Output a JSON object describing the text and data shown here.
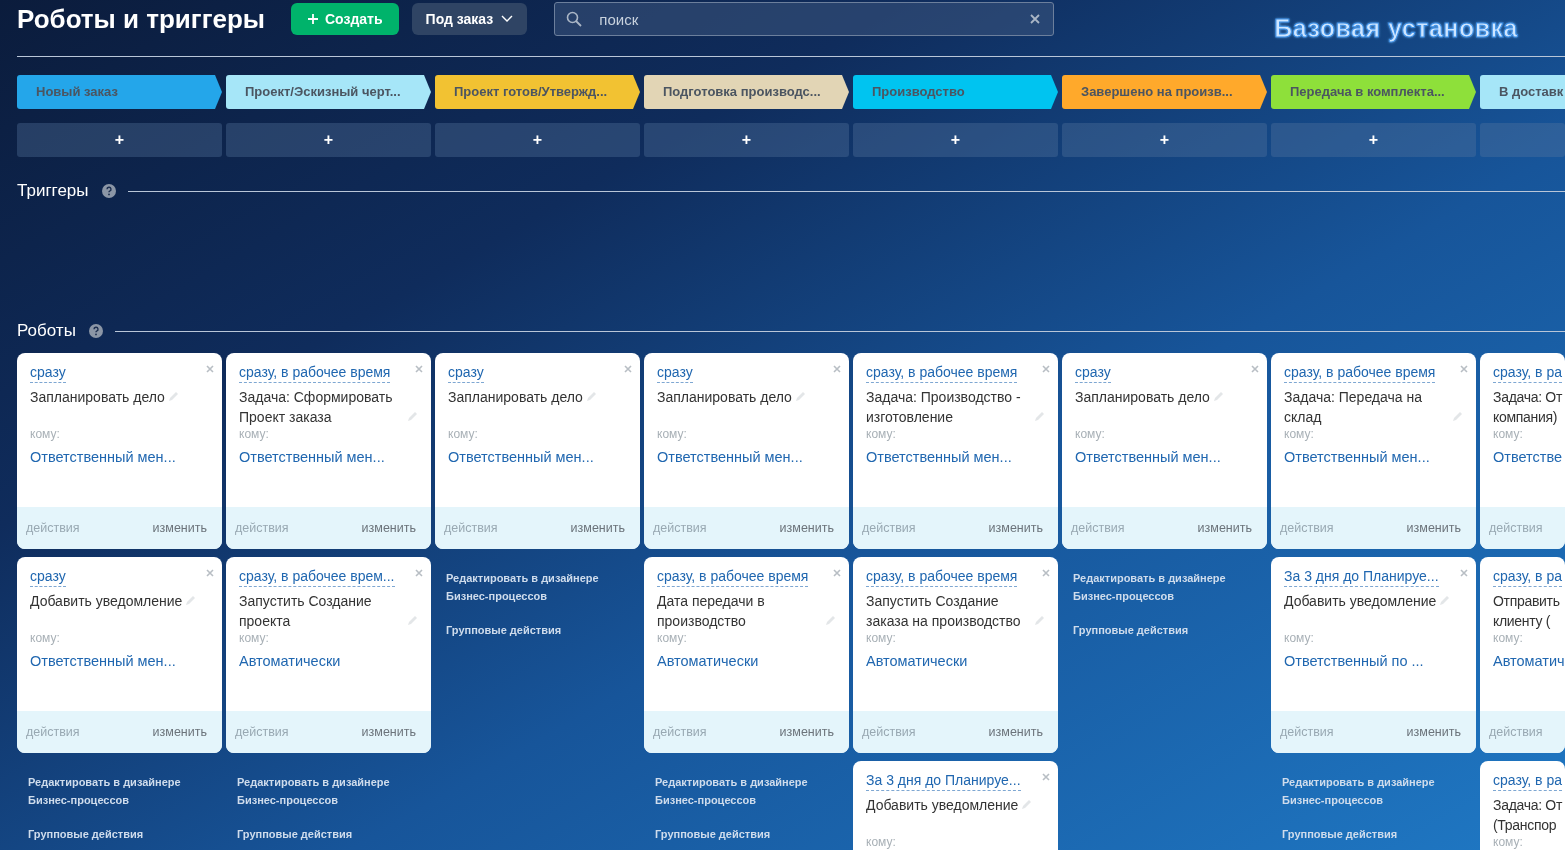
{
  "header": {
    "title": "Роботы и триггеры",
    "create_button": "Создать",
    "mode_dropdown": "Под заказ",
    "search": {
      "placeholder": "поиск"
    },
    "config_name": "Базовая установка"
  },
  "triggers": {
    "title": "Триггеры"
  },
  "robots": {
    "title": "Роботы"
  },
  "columns": [
    {
      "stage": {
        "label": "Новый заказ",
        "color": "#24a6ea"
      },
      "add": "+",
      "cards": [
        {
          "delay": "сразу",
          "title": "Запланировать дело",
          "to_label": "кому:",
          "to": "Ответственный мен...",
          "actions": "действия",
          "edit": "изменить"
        },
        {
          "delay": "сразу",
          "title": "Добавить уведомление",
          "to_label": "кому:",
          "to": "Ответственный мен...",
          "actions": "действия",
          "edit": "изменить"
        }
      ],
      "links": [
        "Редактировать в дизайнере Бизнес-процессов",
        "Групповые действия"
      ]
    },
    {
      "stage": {
        "label": "Проект/Эскизный черт...",
        "color": "#a6e6f8"
      },
      "add": "+",
      "cards": [
        {
          "delay": "сразу, в рабочее время",
          "title": "Задача: Сформировать Проект заказа",
          "to_label": "кому:",
          "to": "Ответственный мен...",
          "actions": "действия",
          "edit": "изменить"
        },
        {
          "delay": "сразу, в рабочее врем...",
          "title": "Запустить Создание проекта",
          "to_label": "кому:",
          "to": "Автоматически",
          "actions": "действия",
          "edit": "изменить"
        }
      ],
      "links": [
        "Редактировать в дизайнере Бизнес-процессов",
        "Групповые действия"
      ]
    },
    {
      "stage": {
        "label": "Проект готов/Утвержд...",
        "color": "#f2c232"
      },
      "add": "+",
      "cards": [
        {
          "delay": "сразу",
          "title": "Запланировать дело",
          "to_label": "кому:",
          "to": "Ответственный мен...",
          "actions": "действия",
          "edit": "изменить"
        }
      ],
      "links": [
        "Редактировать в дизайнере Бизнес-процессов",
        "Групповые действия"
      ]
    },
    {
      "stage": {
        "label": "Подготовка производс...",
        "color": "#e2d5b5"
      },
      "add": "+",
      "cards": [
        {
          "delay": "сразу",
          "title": "Запланировать дело",
          "to_label": "кому:",
          "to": "Ответственный мен...",
          "actions": "действия",
          "edit": "изменить"
        },
        {
          "delay": "сразу, в рабочее время",
          "title": "Дата передачи в производство",
          "to_label": "кому:",
          "to": "Автоматически",
          "actions": "действия",
          "edit": "изменить"
        }
      ],
      "links": [
        "Редактировать в дизайнере Бизнес-процессов",
        "Групповые действия"
      ]
    },
    {
      "stage": {
        "label": "Производство",
        "color": "#00c4f0"
      },
      "add": "+",
      "cards": [
        {
          "delay": "сразу, в рабочее время",
          "title": "Задача: Производство - изготовление",
          "to_label": "кому:",
          "to": "Ответственный мен...",
          "actions": "действия",
          "edit": "изменить"
        },
        {
          "delay": "сразу, в рабочее время",
          "title": "Запустить Создание заказа на производство",
          "to_label": "кому:",
          "to": "Автоматически",
          "actions": "действия",
          "edit": "изменить"
        },
        {
          "delay": "За 3 дня до Планируе...",
          "title": "Добавить уведомление",
          "to_label": "кому:"
        }
      ]
    },
    {
      "stage": {
        "label": "Завершено на произв...",
        "color": "#ffa92b"
      },
      "add": "+",
      "cards": [
        {
          "delay": "сразу",
          "title": "Запланировать дело",
          "to_label": "кому:",
          "to": "Ответственный мен...",
          "actions": "действия",
          "edit": "изменить"
        }
      ],
      "links": [
        "Редактировать в дизайнере Бизнес-процессов",
        "Групповые действия"
      ]
    },
    {
      "stage": {
        "label": "Передача в комплекта...",
        "color": "#8ee03a"
      },
      "add": "+",
      "cards": [
        {
          "delay": "сразу, в рабочее время",
          "title": "Задача: Передача на склад",
          "to_label": "кому:",
          "to": "Ответственный мен...",
          "actions": "действия",
          "edit": "изменить"
        },
        {
          "delay": "За 3 дня до Планируе...",
          "title": "Добавить уведомление",
          "to_label": "кому:",
          "to": "Ответственный по ...",
          "actions": "действия",
          "edit": "изменить"
        }
      ],
      "links": [
        "Редактировать в дизайнере Бизнес-процессов",
        "Групповые действия"
      ]
    },
    {
      "stage": {
        "label": "В доставк",
        "color": "#a6e6f8"
      },
      "cards": [
        {
          "delay": "сразу, в ра",
          "title": "Задача: От\nкомпания)",
          "to_label": "кому:",
          "to": "Ответстве",
          "actions": "действия"
        },
        {
          "delay": "сразу, в ра",
          "title": "Отправить\nклиенту (",
          "to_label": "кому:",
          "to": "Автоматич",
          "actions": "действия"
        },
        {
          "delay": "сразу, в ра",
          "title": "Задача: От\n(Транспор",
          "to_label": "кому:"
        }
      ]
    }
  ]
}
